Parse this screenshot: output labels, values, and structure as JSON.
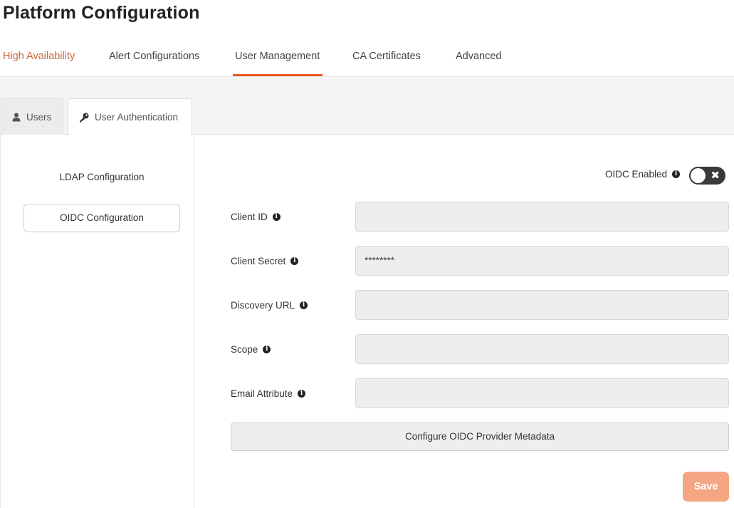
{
  "page_title": "Platform Configuration",
  "top_tabs": [
    {
      "label": "High Availability"
    },
    {
      "label": "Alert Configurations"
    },
    {
      "label": "User Management"
    },
    {
      "label": "CA Certificates"
    },
    {
      "label": "Advanced"
    }
  ],
  "active_top_tab": "User Management",
  "sub_tabs": [
    {
      "label": "Users",
      "icon": "user-icon"
    },
    {
      "label": "User Authentication",
      "icon": "key-icon"
    }
  ],
  "active_sub_tab": "User Authentication",
  "side_menu": {
    "ldap_label": "LDAP Configuration",
    "oidc_label": "OIDC Configuration"
  },
  "oidc": {
    "enabled_label": "OIDC Enabled",
    "enabled": false
  },
  "fields": [
    {
      "label": "Client ID",
      "value": ""
    },
    {
      "label": "Client Secret",
      "value": "********"
    },
    {
      "label": "Discovery URL",
      "value": ""
    },
    {
      "label": "Scope",
      "value": ""
    },
    {
      "label": "Email Attribute",
      "value": ""
    }
  ],
  "metadata_button_label": "Configure OIDC Provider Metadata",
  "save_label": "Save",
  "colors": {
    "accent": "#ef5824",
    "ha_tab": "#d0643a",
    "save_bg": "#f4a582",
    "toggle_bg": "#3a3a3a"
  }
}
